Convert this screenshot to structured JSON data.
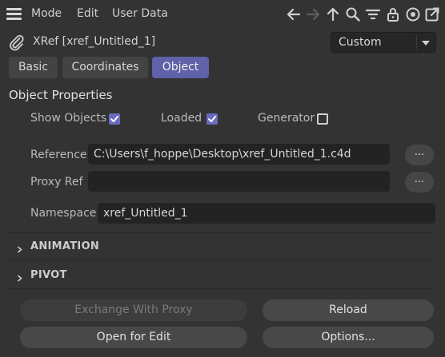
{
  "menu": {
    "mode": "Mode",
    "edit": "Edit",
    "user_data": "User Data"
  },
  "toolbar_icons": [
    "arrow-left-icon",
    "arrow-right-icon",
    "arrow-up-icon",
    "search-icon",
    "filter-icon",
    "lock-icon",
    "target-icon",
    "new-window-icon"
  ],
  "object": {
    "title": "XRef [xref_Untitled_1]",
    "mode_value": "Custom"
  },
  "tabs": [
    {
      "label": "Basic",
      "active": false
    },
    {
      "label": "Coordinates",
      "active": false
    },
    {
      "label": "Object",
      "active": true
    }
  ],
  "properties": {
    "section_title": "Object Properties",
    "show_objects": {
      "label": "Show Objects",
      "checked": true
    },
    "loaded": {
      "label": "Loaded",
      "checked": true
    },
    "generator": {
      "label": "Generator",
      "checked": false
    },
    "reference": {
      "label": "Reference",
      "value": "C:\\Users\\f_hoppe\\Desktop\\xref_Untitled_1.c4d",
      "button": "..."
    },
    "proxy_ref": {
      "label": "Proxy Ref",
      "value": "",
      "button": "..."
    },
    "namespace": {
      "label": "Namespace",
      "value": "xref_Untitled_1"
    }
  },
  "groups": {
    "animation": "ANIMATION",
    "pivot": "PIVOT"
  },
  "buttons": {
    "exchange": "Exchange With Proxy",
    "reload": "Reload",
    "open_for_edit": "Open for Edit",
    "options": "Options..."
  },
  "colors": {
    "background": "#333333",
    "accent": "#5f61a9",
    "checkbox": "#6a6cc0",
    "field": "#232323"
  }
}
